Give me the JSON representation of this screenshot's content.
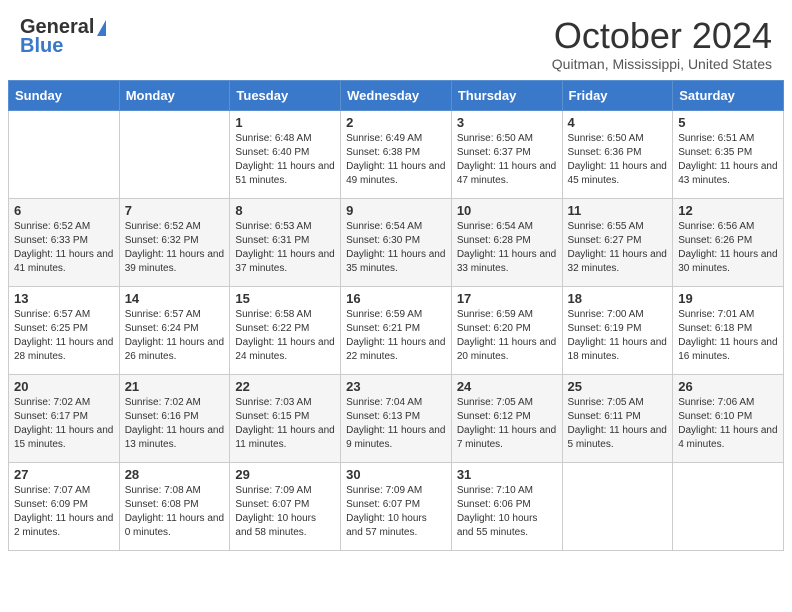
{
  "header": {
    "logo_general": "General",
    "logo_blue": "Blue",
    "title": "October 2024",
    "location": "Quitman, Mississippi, United States"
  },
  "days_of_week": [
    "Sunday",
    "Monday",
    "Tuesday",
    "Wednesday",
    "Thursday",
    "Friday",
    "Saturday"
  ],
  "weeks": [
    [
      {
        "day": "",
        "sunrise": "",
        "sunset": "",
        "daylight": ""
      },
      {
        "day": "",
        "sunrise": "",
        "sunset": "",
        "daylight": ""
      },
      {
        "day": "1",
        "sunrise": "Sunrise: 6:48 AM",
        "sunset": "Sunset: 6:40 PM",
        "daylight": "Daylight: 11 hours and 51 minutes."
      },
      {
        "day": "2",
        "sunrise": "Sunrise: 6:49 AM",
        "sunset": "Sunset: 6:38 PM",
        "daylight": "Daylight: 11 hours and 49 minutes."
      },
      {
        "day": "3",
        "sunrise": "Sunrise: 6:50 AM",
        "sunset": "Sunset: 6:37 PM",
        "daylight": "Daylight: 11 hours and 47 minutes."
      },
      {
        "day": "4",
        "sunrise": "Sunrise: 6:50 AM",
        "sunset": "Sunset: 6:36 PM",
        "daylight": "Daylight: 11 hours and 45 minutes."
      },
      {
        "day": "5",
        "sunrise": "Sunrise: 6:51 AM",
        "sunset": "Sunset: 6:35 PM",
        "daylight": "Daylight: 11 hours and 43 minutes."
      }
    ],
    [
      {
        "day": "6",
        "sunrise": "Sunrise: 6:52 AM",
        "sunset": "Sunset: 6:33 PM",
        "daylight": "Daylight: 11 hours and 41 minutes."
      },
      {
        "day": "7",
        "sunrise": "Sunrise: 6:52 AM",
        "sunset": "Sunset: 6:32 PM",
        "daylight": "Daylight: 11 hours and 39 minutes."
      },
      {
        "day": "8",
        "sunrise": "Sunrise: 6:53 AM",
        "sunset": "Sunset: 6:31 PM",
        "daylight": "Daylight: 11 hours and 37 minutes."
      },
      {
        "day": "9",
        "sunrise": "Sunrise: 6:54 AM",
        "sunset": "Sunset: 6:30 PM",
        "daylight": "Daylight: 11 hours and 35 minutes."
      },
      {
        "day": "10",
        "sunrise": "Sunrise: 6:54 AM",
        "sunset": "Sunset: 6:28 PM",
        "daylight": "Daylight: 11 hours and 33 minutes."
      },
      {
        "day": "11",
        "sunrise": "Sunrise: 6:55 AM",
        "sunset": "Sunset: 6:27 PM",
        "daylight": "Daylight: 11 hours and 32 minutes."
      },
      {
        "day": "12",
        "sunrise": "Sunrise: 6:56 AM",
        "sunset": "Sunset: 6:26 PM",
        "daylight": "Daylight: 11 hours and 30 minutes."
      }
    ],
    [
      {
        "day": "13",
        "sunrise": "Sunrise: 6:57 AM",
        "sunset": "Sunset: 6:25 PM",
        "daylight": "Daylight: 11 hours and 28 minutes."
      },
      {
        "day": "14",
        "sunrise": "Sunrise: 6:57 AM",
        "sunset": "Sunset: 6:24 PM",
        "daylight": "Daylight: 11 hours and 26 minutes."
      },
      {
        "day": "15",
        "sunrise": "Sunrise: 6:58 AM",
        "sunset": "Sunset: 6:22 PM",
        "daylight": "Daylight: 11 hours and 24 minutes."
      },
      {
        "day": "16",
        "sunrise": "Sunrise: 6:59 AM",
        "sunset": "Sunset: 6:21 PM",
        "daylight": "Daylight: 11 hours and 22 minutes."
      },
      {
        "day": "17",
        "sunrise": "Sunrise: 6:59 AM",
        "sunset": "Sunset: 6:20 PM",
        "daylight": "Daylight: 11 hours and 20 minutes."
      },
      {
        "day": "18",
        "sunrise": "Sunrise: 7:00 AM",
        "sunset": "Sunset: 6:19 PM",
        "daylight": "Daylight: 11 hours and 18 minutes."
      },
      {
        "day": "19",
        "sunrise": "Sunrise: 7:01 AM",
        "sunset": "Sunset: 6:18 PM",
        "daylight": "Daylight: 11 hours and 16 minutes."
      }
    ],
    [
      {
        "day": "20",
        "sunrise": "Sunrise: 7:02 AM",
        "sunset": "Sunset: 6:17 PM",
        "daylight": "Daylight: 11 hours and 15 minutes."
      },
      {
        "day": "21",
        "sunrise": "Sunrise: 7:02 AM",
        "sunset": "Sunset: 6:16 PM",
        "daylight": "Daylight: 11 hours and 13 minutes."
      },
      {
        "day": "22",
        "sunrise": "Sunrise: 7:03 AM",
        "sunset": "Sunset: 6:15 PM",
        "daylight": "Daylight: 11 hours and 11 minutes."
      },
      {
        "day": "23",
        "sunrise": "Sunrise: 7:04 AM",
        "sunset": "Sunset: 6:13 PM",
        "daylight": "Daylight: 11 hours and 9 minutes."
      },
      {
        "day": "24",
        "sunrise": "Sunrise: 7:05 AM",
        "sunset": "Sunset: 6:12 PM",
        "daylight": "Daylight: 11 hours and 7 minutes."
      },
      {
        "day": "25",
        "sunrise": "Sunrise: 7:05 AM",
        "sunset": "Sunset: 6:11 PM",
        "daylight": "Daylight: 11 hours and 5 minutes."
      },
      {
        "day": "26",
        "sunrise": "Sunrise: 7:06 AM",
        "sunset": "Sunset: 6:10 PM",
        "daylight": "Daylight: 11 hours and 4 minutes."
      }
    ],
    [
      {
        "day": "27",
        "sunrise": "Sunrise: 7:07 AM",
        "sunset": "Sunset: 6:09 PM",
        "daylight": "Daylight: 11 hours and 2 minutes."
      },
      {
        "day": "28",
        "sunrise": "Sunrise: 7:08 AM",
        "sunset": "Sunset: 6:08 PM",
        "daylight": "Daylight: 11 hours and 0 minutes."
      },
      {
        "day": "29",
        "sunrise": "Sunrise: 7:09 AM",
        "sunset": "Sunset: 6:07 PM",
        "daylight": "Daylight: 10 hours and 58 minutes."
      },
      {
        "day": "30",
        "sunrise": "Sunrise: 7:09 AM",
        "sunset": "Sunset: 6:07 PM",
        "daylight": "Daylight: 10 hours and 57 minutes."
      },
      {
        "day": "31",
        "sunrise": "Sunrise: 7:10 AM",
        "sunset": "Sunset: 6:06 PM",
        "daylight": "Daylight: 10 hours and 55 minutes."
      },
      {
        "day": "",
        "sunrise": "",
        "sunset": "",
        "daylight": ""
      },
      {
        "day": "",
        "sunrise": "",
        "sunset": "",
        "daylight": ""
      }
    ]
  ]
}
